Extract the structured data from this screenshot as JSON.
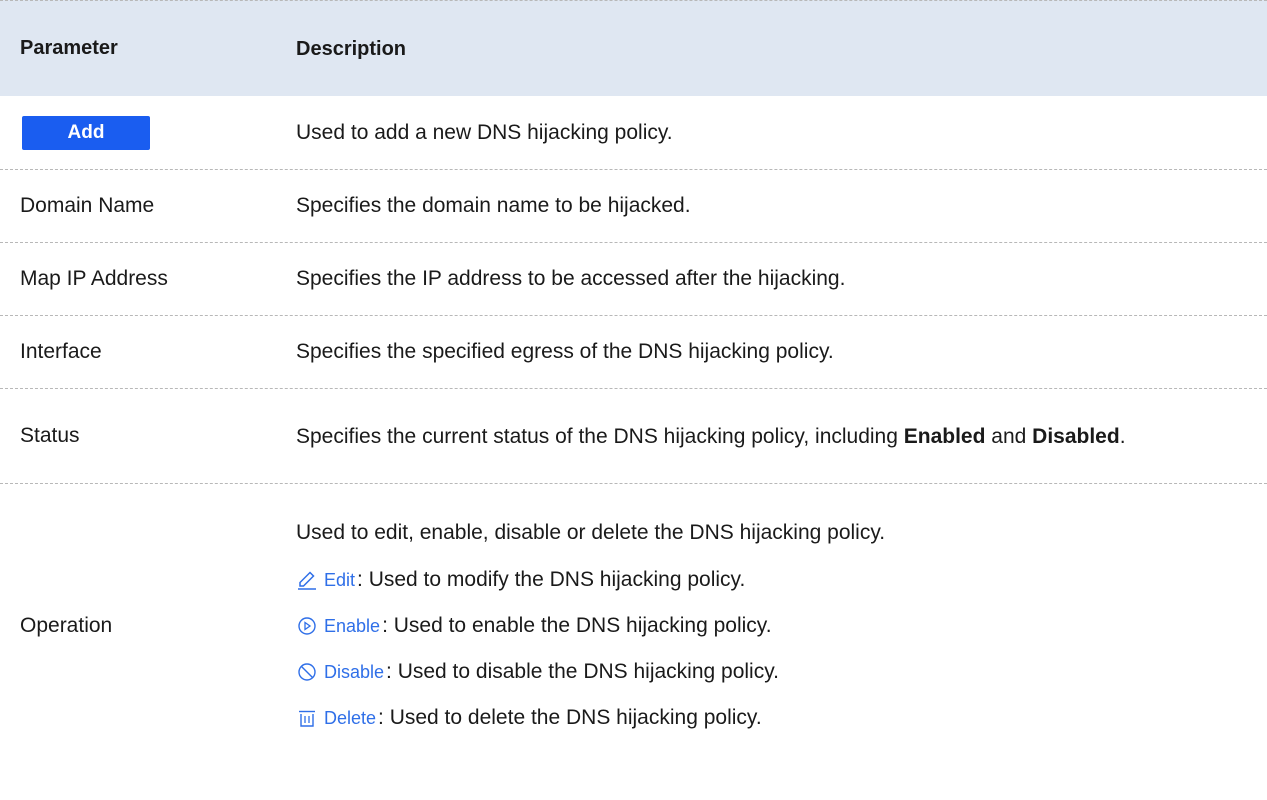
{
  "header": {
    "param": "Parameter",
    "desc": "Description"
  },
  "rows": [
    {
      "button_label": "Add",
      "desc": "Used to add a new DNS hijacking policy."
    },
    {
      "param": "Domain Name",
      "desc": "Specifies the domain name to be hijacked."
    },
    {
      "param": "Map IP Address",
      "desc": "Specifies the IP address to be accessed after the hijacking."
    },
    {
      "param": "Interface",
      "desc": "Specifies the specified egress of the DNS hijacking policy."
    },
    {
      "param": "Status",
      "desc_prefix": "Specifies the current status of the DNS hijacking policy, including ",
      "enabled": "Enabled",
      "and": " and ",
      "disabled": "Disabled",
      "period": "."
    },
    {
      "param": "Operation",
      "intro": "Used to edit, enable, disable or delete the DNS hijacking policy.",
      "actions": [
        {
          "label": "Edit",
          "icon": "pencil-icon",
          "desc": ": Used to modify the DNS hijacking policy."
        },
        {
          "label": "Enable",
          "icon": "play-circle-icon",
          "desc": ": Used to enable the DNS hijacking policy."
        },
        {
          "label": "Disable",
          "icon": "prohibited-icon",
          "desc": ": Used to disable the DNS hijacking policy."
        },
        {
          "label": "Delete",
          "icon": "trash-icon",
          "desc": ": Used to delete the DNS hijacking policy."
        }
      ]
    }
  ],
  "colors": {
    "header_bg": "#dfe7f2",
    "button_bg": "#1a5df0",
    "action_text": "#2f6fe8"
  }
}
